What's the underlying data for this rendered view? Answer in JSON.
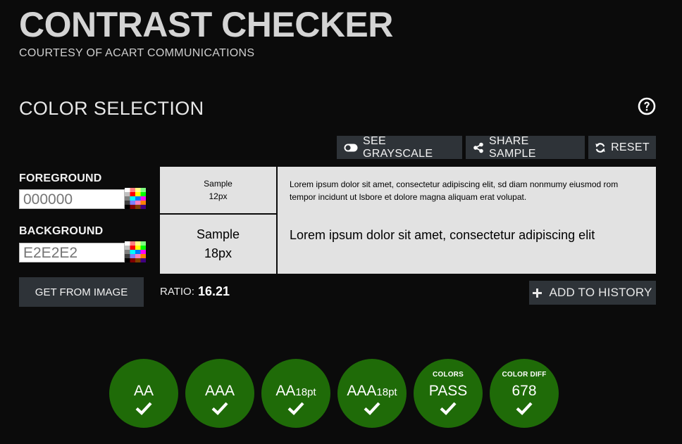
{
  "header": {
    "title": "CONTRAST CHECKER",
    "subtitle": "COURTESY OF ACART COMMUNICATIONS"
  },
  "section": {
    "title": "COLOR SELECTION",
    "help_icon": "question-circle-icon"
  },
  "toolbar": {
    "grayscale_label": "SEE GRAYSCALE",
    "share_label": "SHARE SAMPLE",
    "reset_label": "RESET"
  },
  "foreground": {
    "label": "FOREGROUND",
    "placeholder": "000000",
    "value": ""
  },
  "background": {
    "label": "BACKGROUND",
    "placeholder": "E2E2E2",
    "value": ""
  },
  "get_image_label": "GET FROM IMAGE",
  "samples": {
    "small_label_line1": "Sample",
    "small_label_line2": "12px",
    "small_text": "Lorem ipsum dolor sit amet, consectetur adipiscing elit, sd diam nonmumy eiusmod rom tempor incidunt ut lsbore et dolore magna aliquam erat volupat.",
    "large_label_line1": "Sample",
    "large_label_line2": "18px",
    "large_text": "Lorem ipsum dolor sit amet, consectetur adipiscing elit",
    "background_color": "#E2E2E2",
    "text_color": "#000000"
  },
  "ratio": {
    "label": "RATIO:",
    "value": "16.21"
  },
  "add_history_label": "ADD TO HISTORY",
  "badges": [
    {
      "small": "",
      "main": "AA",
      "sub": "",
      "status": "pass"
    },
    {
      "small": "",
      "main": "AAA",
      "sub": "",
      "status": "pass"
    },
    {
      "small": "",
      "main": "AA",
      "sub": "18pt",
      "status": "pass"
    },
    {
      "small": "",
      "main": "AAA",
      "sub": "18pt",
      "status": "pass"
    },
    {
      "small": "COLORS",
      "main": "PASS",
      "sub": "",
      "status": "pass"
    },
    {
      "small": "COLOR DIFF",
      "main": "678",
      "sub": "",
      "status": "pass"
    }
  ],
  "colors": {
    "pass_green": "#1F6B08",
    "button_bg": "#2E3338",
    "page_bg": "#0B0B0B"
  }
}
